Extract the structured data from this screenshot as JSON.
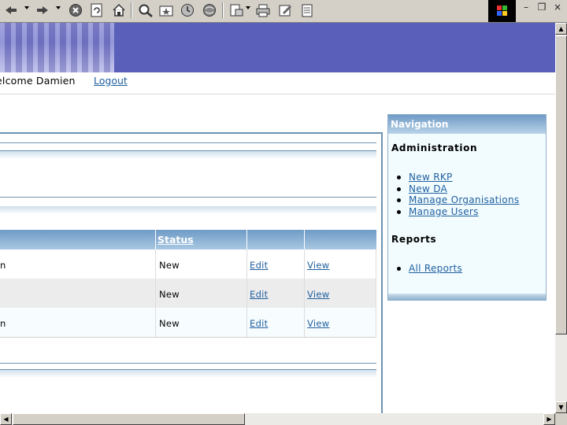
{
  "toolbar": {
    "icons": [
      "back-arrow-icon",
      "forward-arrow-icon",
      "stop-icon",
      "refresh-icon",
      "home-icon",
      "search-icon",
      "favorites-icon",
      "history-icon",
      "media-icon",
      "mail-icon",
      "print-icon",
      "edit-icon",
      "discuss-icon"
    ]
  },
  "window": {
    "minimize": "–",
    "restore": "❐",
    "close": "×"
  },
  "header": {
    "welcome_text": "elcome Damien",
    "logout_label": "Logout"
  },
  "table": {
    "status_header": "Status",
    "rows": [
      {
        "name_fragment": "n",
        "status": "New",
        "edit_label": "Edit",
        "view_label": "View"
      },
      {
        "name_fragment": "",
        "status": "New",
        "edit_label": "Edit",
        "view_label": "View"
      },
      {
        "name_fragment": "n",
        "status": "New",
        "edit_label": "Edit",
        "view_label": "View"
      }
    ]
  },
  "navigation": {
    "title": "Navigation",
    "administration_heading": "Administration",
    "admin_links": [
      "New RKP",
      "New DA",
      "Manage Organisations",
      "Manage Users"
    ],
    "reports_heading": "Reports",
    "report_links": [
      "All Reports"
    ]
  },
  "colors": {
    "banner": "#5a5fba",
    "link": "#1f5f9f",
    "header_gradient_top": "#6f9bc6",
    "nav_background": "#f2fcff"
  }
}
